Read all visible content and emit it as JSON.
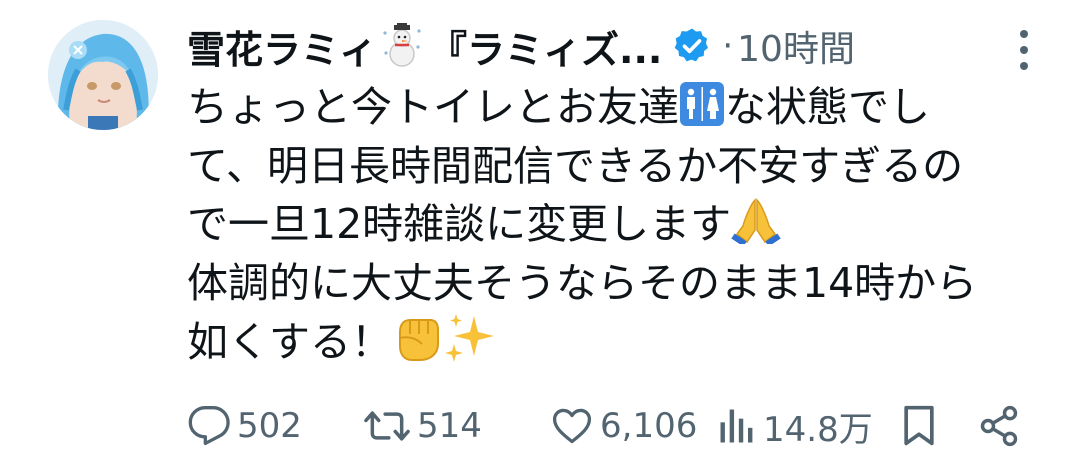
{
  "author": {
    "display_name": "雪花ラミィ",
    "display_name_suffix": "『ラミィズ...",
    "verified_icon": "verified-badge-icon",
    "decor_icon": "snowman-icon"
  },
  "meta": {
    "separator": "·",
    "time": "10時間"
  },
  "tweet": {
    "line1_a": "ちょっと今トイレとお友達",
    "line1_b": "な状態でし",
    "line2": "て、明日長時間配信できるか不安すぎるの",
    "line3": "で一旦12時雑談に変更します",
    "line4": "体調的に大丈夫そうならそのまま14時から",
    "line5": "如くする！"
  },
  "actions": {
    "replies": "502",
    "retweets": "514",
    "likes": "6,106",
    "views": "14.8万"
  },
  "colors": {
    "text": "#0f1419",
    "muted": "#536471",
    "verified": "#1d9bf0",
    "restroom": "#3e8ae0"
  }
}
